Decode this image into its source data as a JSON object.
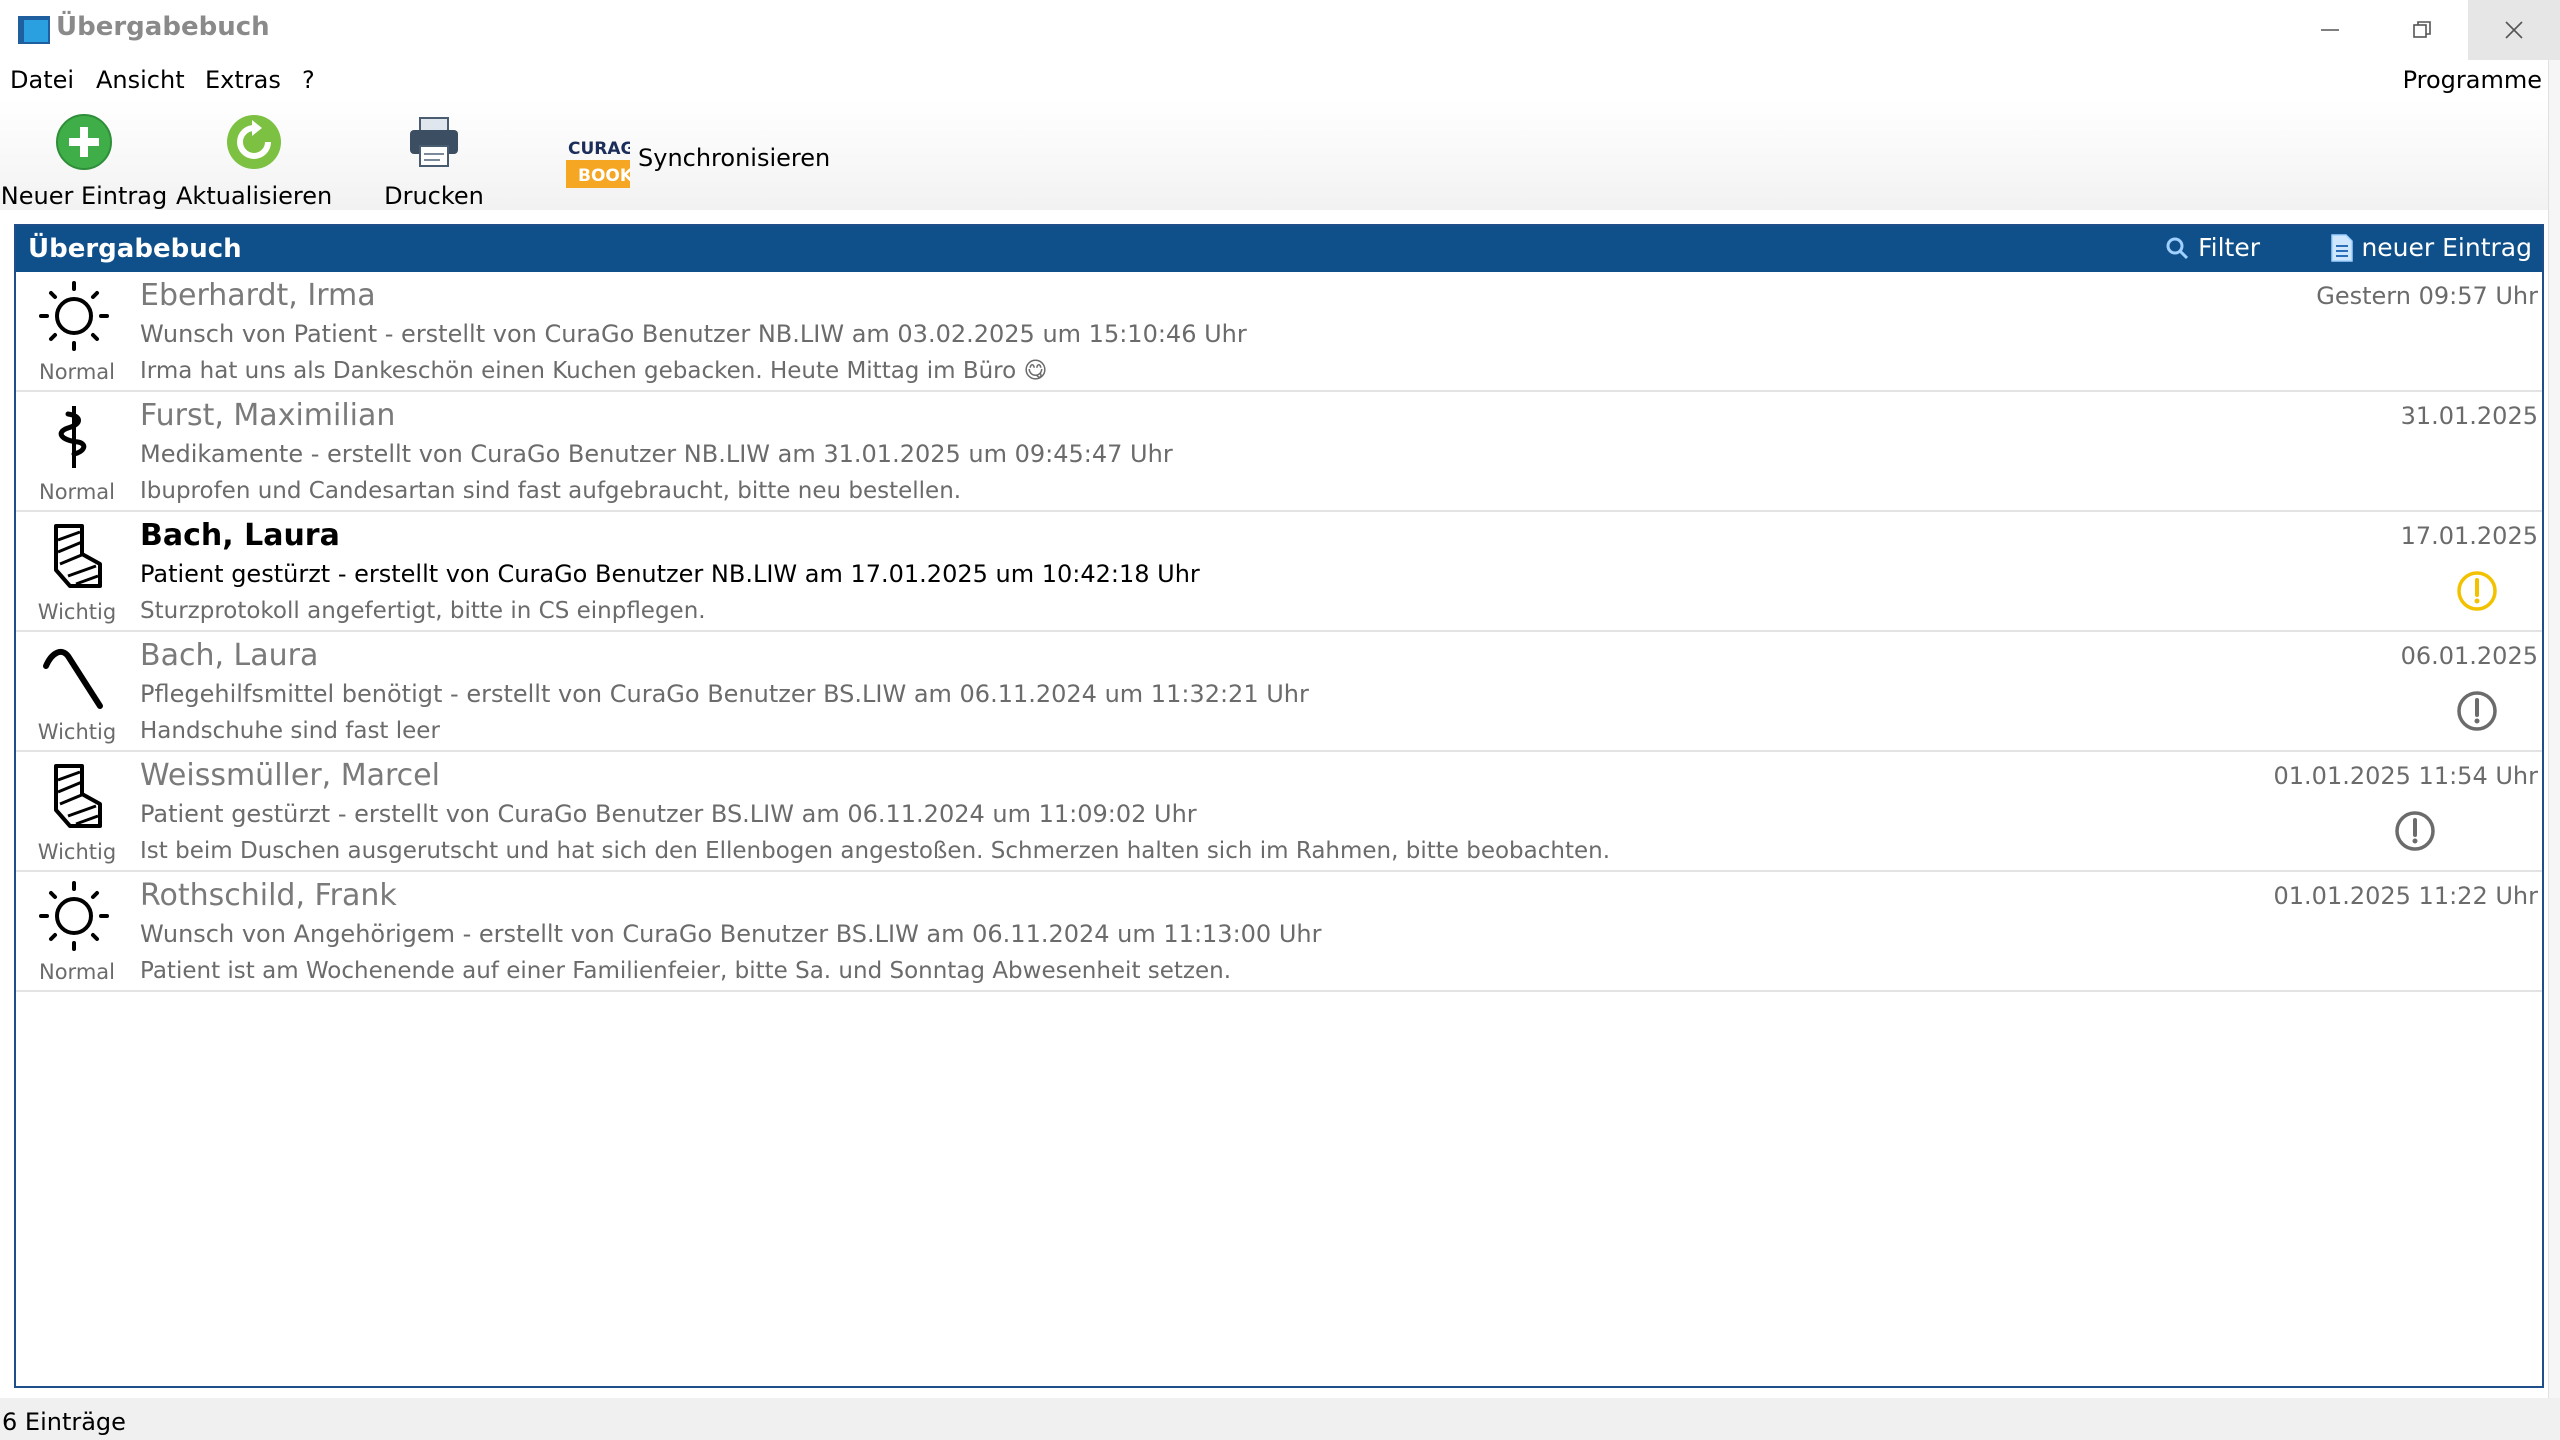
{
  "window": {
    "title": "Übergabebuch"
  },
  "menu": {
    "items": [
      "Datei",
      "Ansicht",
      "Extras",
      "?"
    ],
    "right": "Programme"
  },
  "toolbar": {
    "new_entry": "Neuer Eintrag",
    "refresh": "Aktualisieren",
    "print": "Drucken",
    "sync_logo_top": "CURAGO",
    "sync_logo_bottom": "BOOK",
    "sync": "Synchronisieren"
  },
  "panel": {
    "title": "Übergabebuch",
    "filter": "Filter",
    "new_entry": "neuer Eintrag"
  },
  "entries": [
    {
      "icon": "sun-icon",
      "priority": "Normal",
      "name": "Eberhardt, Irma",
      "subtitle": "Wunsch von Patient - erstellt von CuraGo Benutzer NB.LIW am 03.02.2025 um 15:10:46 Uhr",
      "note": "Irma hat uns als Dankeschön einen Kuchen gebacken. Heute Mittag im Büro 😋",
      "date": "Gestern 09:57 Uhr",
      "bold": false,
      "alert": "none"
    },
    {
      "icon": "caduceus-icon",
      "priority": "Normal",
      "name": "Furst, Maximilian",
      "subtitle": "Medikamente - erstellt von CuraGo Benutzer NB.LIW am 31.01.2025 um 09:45:47 Uhr",
      "note": "Ibuprofen und Candesartan sind fast aufgebraucht, bitte neu bestellen.",
      "date": "31.01.2025",
      "bold": false,
      "alert": "none"
    },
    {
      "icon": "cast-leg-icon",
      "priority": "Wichtig",
      "name": "Bach, Laura",
      "subtitle": "Patient gestürzt - erstellt von CuraGo Benutzer NB.LIW am 17.01.2025 um 10:42:18 Uhr",
      "note": "Sturzprotokoll angefertigt, bitte in CS einpflegen.",
      "date": "17.01.2025",
      "bold": true,
      "alert": "yellow"
    },
    {
      "icon": "walking-cane-icon",
      "priority": "Wichtig",
      "name": "Bach, Laura",
      "subtitle": "Pflegehilfsmittel benötigt - erstellt von CuraGo Benutzer BS.LIW am 06.11.2024 um 11:32:21 Uhr",
      "note": "Handschuhe sind fast leer",
      "date": "06.01.2025",
      "bold": false,
      "alert": "grey"
    },
    {
      "icon": "cast-leg-icon",
      "priority": "Wichtig",
      "name": "Weissmüller, Marcel",
      "subtitle": "Patient gestürzt - erstellt von CuraGo Benutzer BS.LIW am 06.11.2024 um 11:09:02 Uhr",
      "note": "Ist beim Duschen ausgerutscht und hat sich den Ellenbogen angestoßen. Schmerzen halten sich im Rahmen, bitte beobachten.",
      "date": "01.01.2025 11:54 Uhr",
      "bold": false,
      "alert": "grey-left"
    },
    {
      "icon": "sun-icon",
      "priority": "Normal",
      "name": "Rothschild, Frank",
      "subtitle": "Wunsch von Angehörigem - erstellt von CuraGo Benutzer BS.LIW am 06.11.2024 um 11:13:00 Uhr",
      "note": "Patient ist am Wochenende auf einer Familienfeier, bitte Sa. und Sonntag Abwesenheit setzen.",
      "date": "01.01.2025 11:22 Uhr",
      "bold": false,
      "alert": "none"
    }
  ],
  "status": {
    "text": "6 Einträge"
  },
  "colors": {
    "header": "#0f4f8a",
    "alert_yellow": "#f2c200",
    "alert_grey": "#6b6b6b",
    "green": "#3fae49"
  }
}
